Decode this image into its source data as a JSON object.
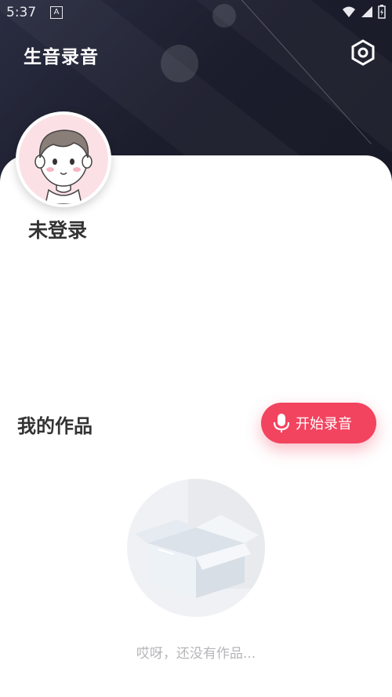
{
  "status_bar": {
    "time": "5:37",
    "notification_icon": "A"
  },
  "header": {
    "title": "生音录音",
    "settings_icon": "gear-hexagon-icon"
  },
  "profile": {
    "login_status": "未登录"
  },
  "works": {
    "title": "我的作品",
    "record_button": {
      "label": "开始录音",
      "icon": "microphone-icon"
    },
    "empty_text": "哎呀，还没有作品..."
  },
  "colors": {
    "accent": "#f2435f",
    "header_bg": "#1f2233",
    "avatar_bg": "#fbe1e6",
    "title_text": "#333333",
    "empty_text": "#b5b5b9"
  }
}
